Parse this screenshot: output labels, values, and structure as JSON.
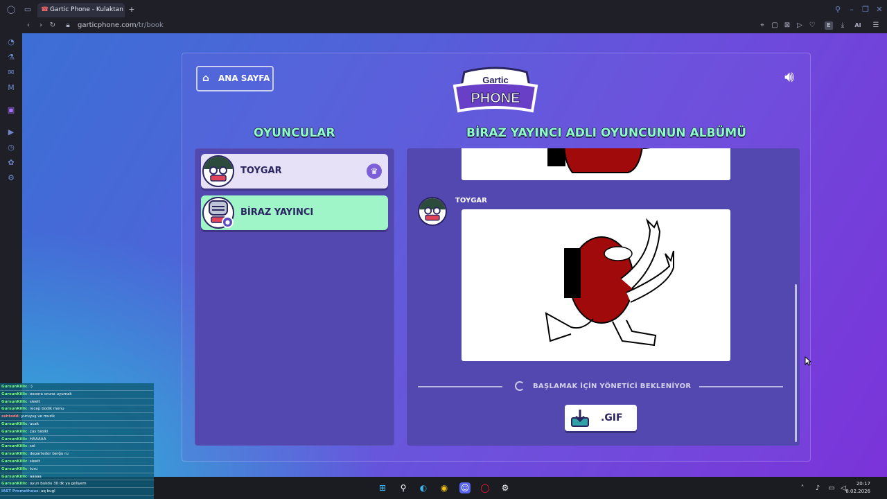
{
  "browser": {
    "tab_title": "Gartic Phone - Kulaktan Ku",
    "new_tab_symbol": "+",
    "url_host": "garticphone.com",
    "url_path": "/tr/book",
    "profile_badge": "E",
    "ai_label": "AI"
  },
  "game": {
    "home_button": "ANA SAYFA",
    "logo_top": "Gartic",
    "logo_bottom": "PHONE",
    "players_heading": "OYUNCULAR",
    "album_heading": "BİRAZ YAYINCI ADLI OYUNCUNUN ALBÜMÜ",
    "players": [
      {
        "name": "TOYGAR",
        "host": true,
        "color": "#e6e1f6"
      },
      {
        "name": "BİRAZ YAYINCI",
        "host": false,
        "color": "#9ff5c8"
      }
    ],
    "album_author": "TOYGAR",
    "waiting_text": "BAŞLAMAK İÇİN YÖNETİCİ BEKLENİYOR",
    "gif_button": ".GIF",
    "accent_green": "#8dffc5",
    "drawing_red": "#a00a0a"
  },
  "chat": {
    "lines": [
      {
        "user": "GursunKillic",
        "text": ": :)",
        "color": "#7dff7d"
      },
      {
        "user": "GursunKillic",
        "text": ": oooora oruna uyumak",
        "color": "#7dff7d"
      },
      {
        "user": "GursunKillic",
        "text": ": sieelt",
        "color": "#7dff7d"
      },
      {
        "user": "GursunKillic",
        "text": ": recep bodik menu",
        "color": "#7dff7d"
      },
      {
        "user": "sshtodd",
        "text": ": yuruyuş ve muzik",
        "color": "#ff7d7d"
      },
      {
        "user": "GursunKillic",
        "text": ": ucak",
        "color": "#7dff7d"
      },
      {
        "user": "GursunKillic",
        "text": ": çay tabiki",
        "color": "#7dff7d"
      },
      {
        "user": "GursunKillic",
        "text": ": HAAAAA",
        "color": "#7dff7d"
      },
      {
        "user": "GursunKillic",
        "text": ": sol",
        "color": "#7dff7d"
      },
      {
        "user": "GursunKillic",
        "text": ": departedor berğu ru",
        "color": "#7dff7d"
      },
      {
        "user": "GursunKillic",
        "text": ": sieelt",
        "color": "#7dff7d"
      },
      {
        "user": "GursunKillic",
        "text": ": turu",
        "color": "#7dff7d"
      },
      {
        "user": "GursunKillic",
        "text": ": aaaaa",
        "color": "#7dff7d"
      },
      {
        "user": "GursunKillic",
        "text": ": oyun bukdu 30 dk ya geliyem",
        "color": "#7dff7d"
      },
      {
        "user": "IAST Prometheus",
        "text": ": aq bugl",
        "color": "#7db8ff"
      }
    ]
  },
  "taskbar": {
    "time": "20:17",
    "date": "8.02.2026"
  }
}
